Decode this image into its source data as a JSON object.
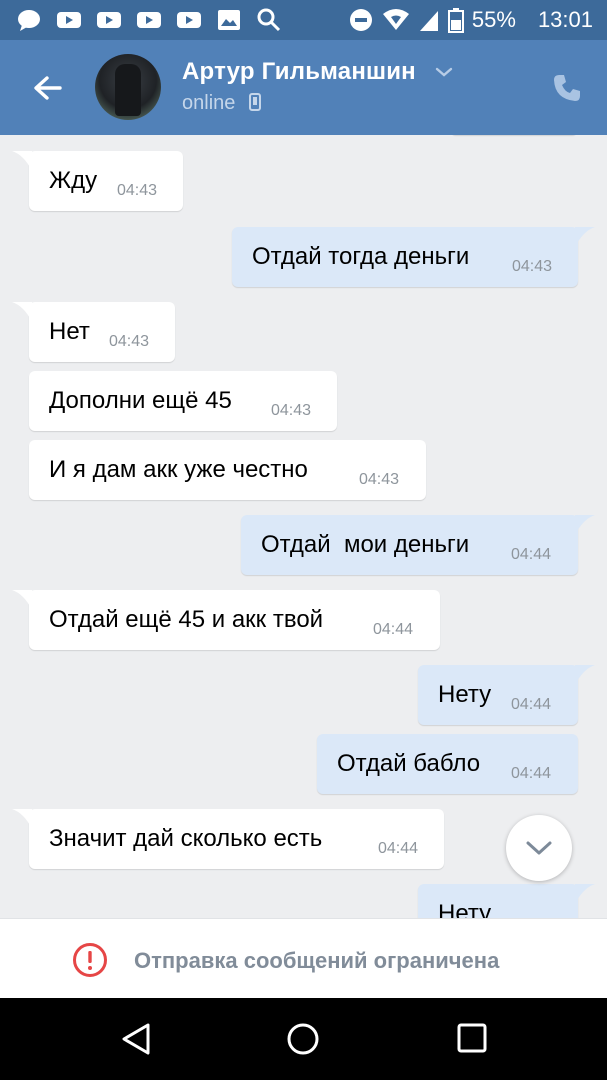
{
  "status_bar": {
    "battery": "55%",
    "time": "13:01"
  },
  "header": {
    "contact_name": "Артур Гильманшин",
    "status": "online"
  },
  "messages": [
    {
      "dir": "in",
      "text": "Жду",
      "time": "04:43"
    },
    {
      "dir": "out",
      "text": "Отдай тогда деньги",
      "time": "04:43"
    },
    {
      "dir": "in",
      "text": "Нет",
      "time": "04:43"
    },
    {
      "dir": "in",
      "text": "Дополни ещё 45",
      "time": "04:43"
    },
    {
      "dir": "in",
      "text": "И я дам акк уже честно",
      "time": "04:43"
    },
    {
      "dir": "out",
      "text": "Отдай  мои деньги",
      "time": "04:44"
    },
    {
      "dir": "in",
      "text": "Отдай ещё 45 и акк твой",
      "time": "04:44"
    },
    {
      "dir": "out",
      "text": "Нету",
      "time": "04:44"
    },
    {
      "dir": "out",
      "text": "Отдай бабло",
      "time": "04:44"
    },
    {
      "dir": "in",
      "text": "Значит дай сколько есть",
      "time": "04:44"
    },
    {
      "dir": "out",
      "text": "Нету",
      "time": ""
    }
  ],
  "restriction": {
    "text": "Отправка сообщений ограничена"
  },
  "colors": {
    "header": "#5181b8",
    "status_bar": "#3d6a9a",
    "incoming_bubble": "#ffffff",
    "outgoing_bubble": "#dbe8f8",
    "background": "#edeef0",
    "warning": "#e64646"
  }
}
